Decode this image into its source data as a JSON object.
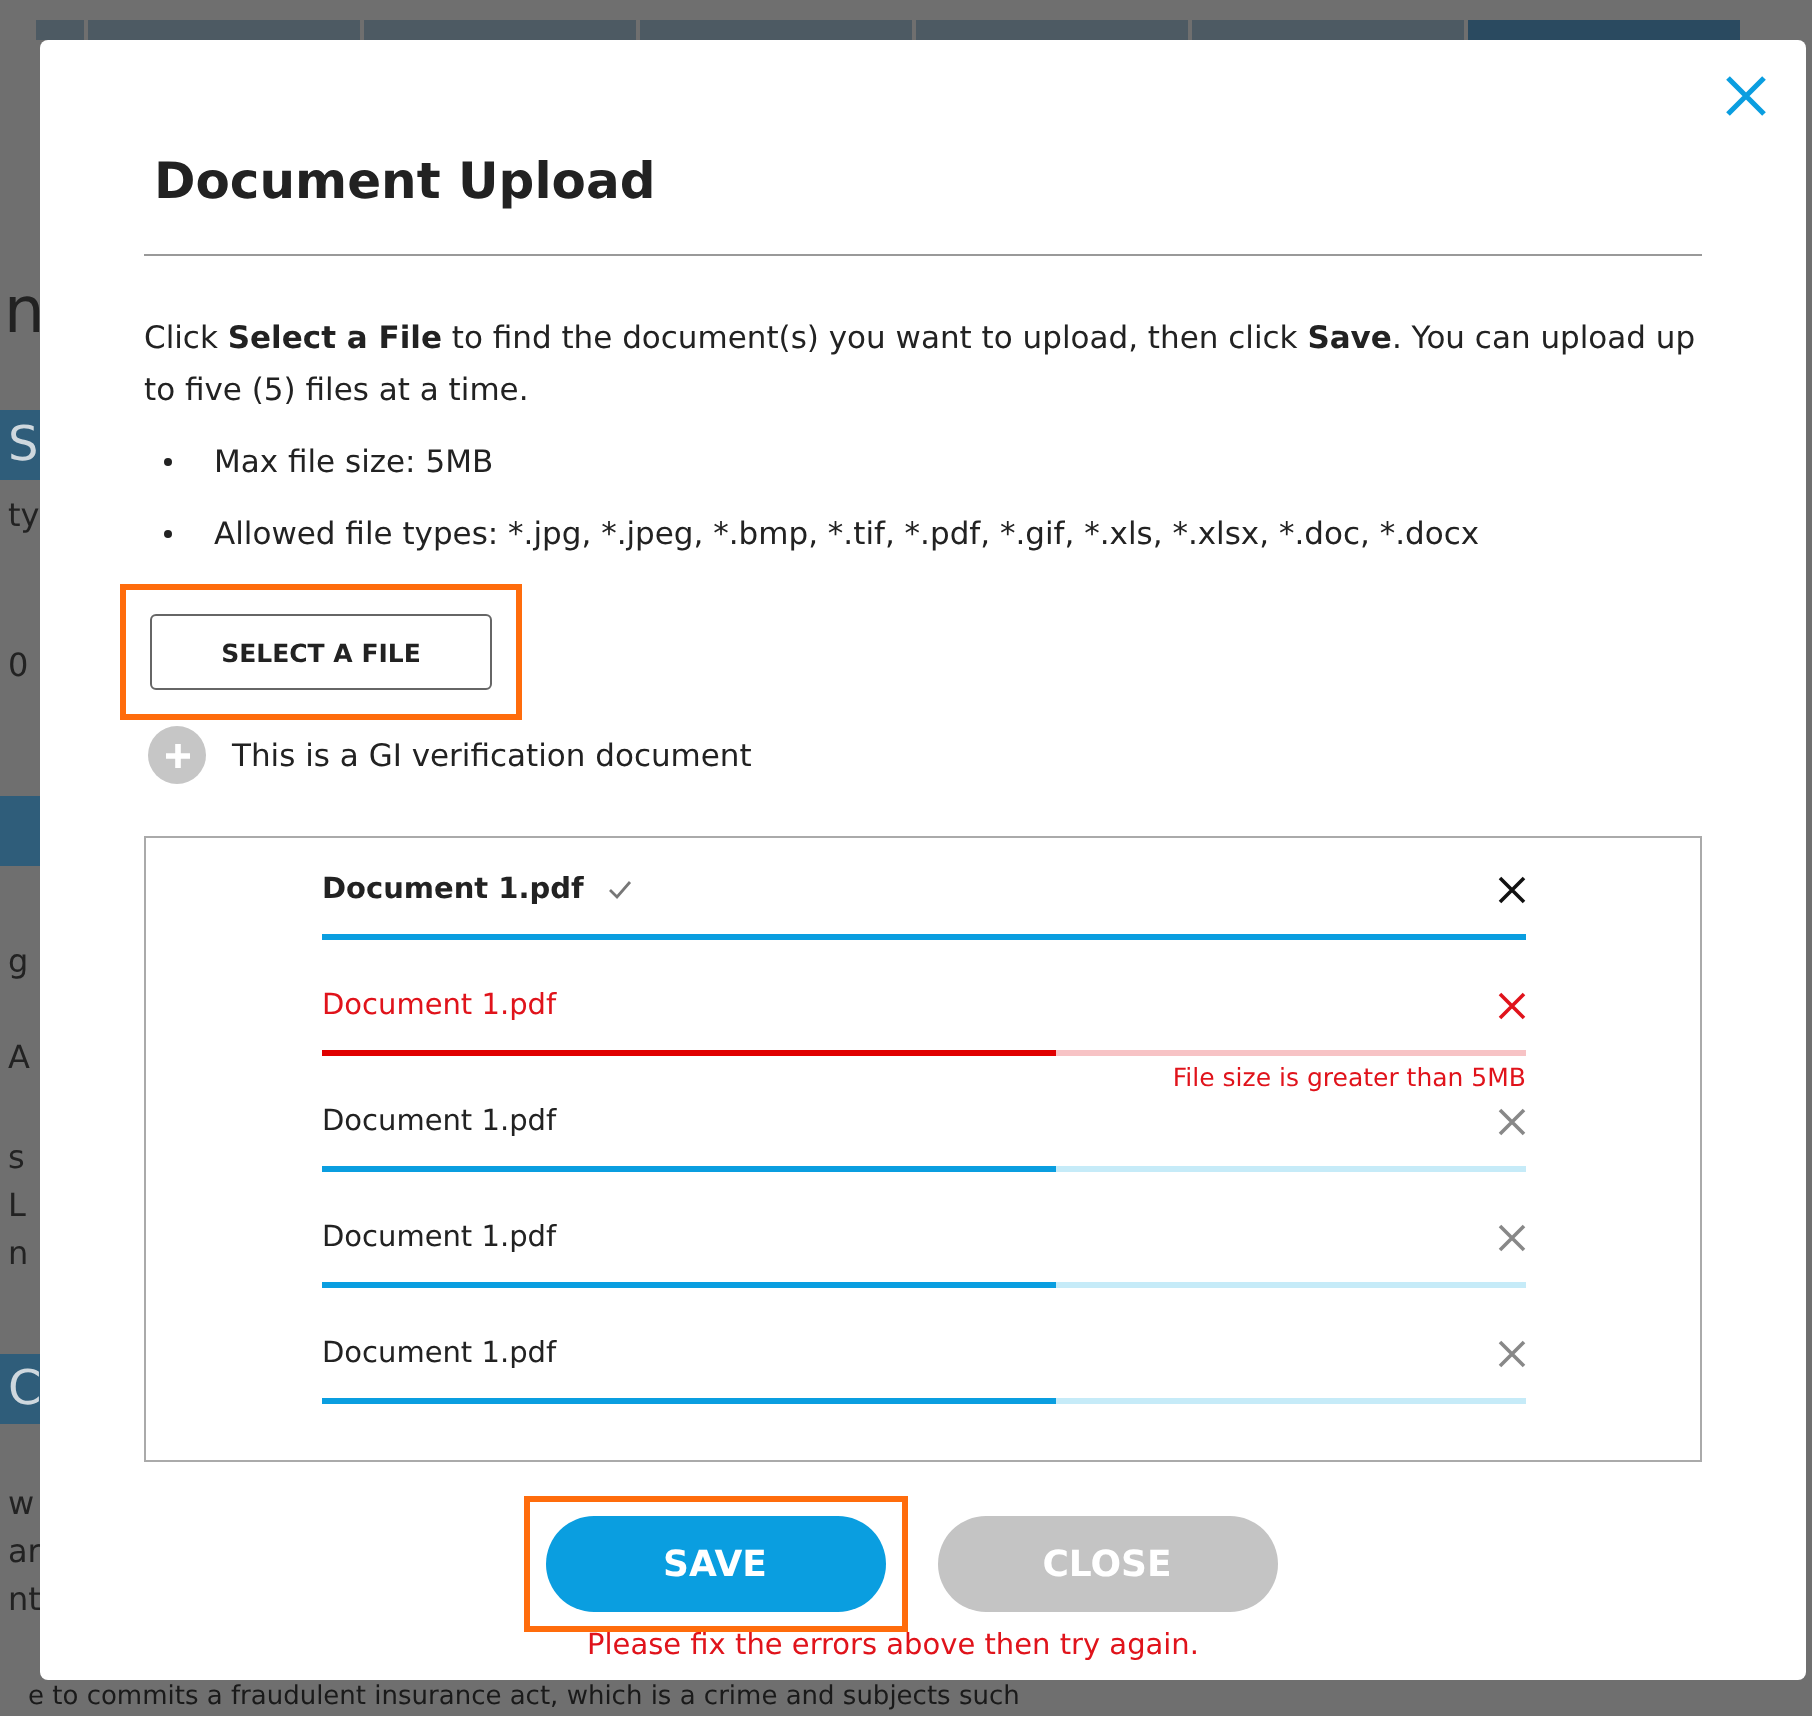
{
  "background_page": {
    "fragments": [
      {
        "text": "n",
        "kind": "heading"
      },
      {
        "text": "S",
        "kind": "band"
      },
      {
        "text": "ty",
        "kind": "line"
      },
      {
        "text": "0",
        "kind": "field"
      },
      {
        "kind": "band"
      },
      {
        "text": "g",
        "kind": "line"
      },
      {
        "text": "A",
        "kind": "line"
      },
      {
        "text": "s",
        "kind": "para"
      },
      {
        "text": "L",
        "kind": "line"
      },
      {
        "text": "n",
        "kind": "line"
      },
      {
        "text": "C",
        "kind": "band"
      },
      {
        "text": "w",
        "kind": "para"
      },
      {
        "text": "ar",
        "kind": "line"
      },
      {
        "text": "nt",
        "kind": "line"
      }
    ],
    "footer_text": "e to commits a fraudulent insurance act, which is a crime and subjects such"
  },
  "dialog": {
    "title": "Document Upload",
    "intro": "Click **Select a File** to find the document(s) you want to upload, then click **Save**. You can upload up to five (5) files at a time.",
    "bullets": [
      "Max file size: 5MB",
      "Allowed file types: *.jpg, *.jpeg, *.bmp, *.tif, *.pdf, *.gif, *.xls, *.xlsx, *.doc, *.docx"
    ],
    "select_button": {
      "label": "SELECT A FILE",
      "highlighted": true
    },
    "gi_option": {
      "label": "This is a GI verification document",
      "checked": false
    },
    "files": [
      {
        "name": "Document 1.pdf",
        "kind": "complete",
        "level": 1
      },
      {
        "name": "Document 1.pdf",
        "kind": "error",
        "level": 0.61,
        "error": "File size is greater than 5MB"
      },
      {
        "name": "Document 1.pdf",
        "kind": "uploading",
        "level": 0.61
      },
      {
        "name": "Document 1.pdf",
        "kind": "uploading",
        "level": 0.61
      },
      {
        "name": "Document 1.pdf",
        "kind": "uploading",
        "level": 0.61
      }
    ],
    "buttons": [
      {
        "label": "SAVE",
        "kind": "primary",
        "highlighted": true
      },
      {
        "label": "CLOSE",
        "kind": "secondary",
        "highlighted": false
      }
    ],
    "error_message": "Please fix the errors above then try again."
  }
}
